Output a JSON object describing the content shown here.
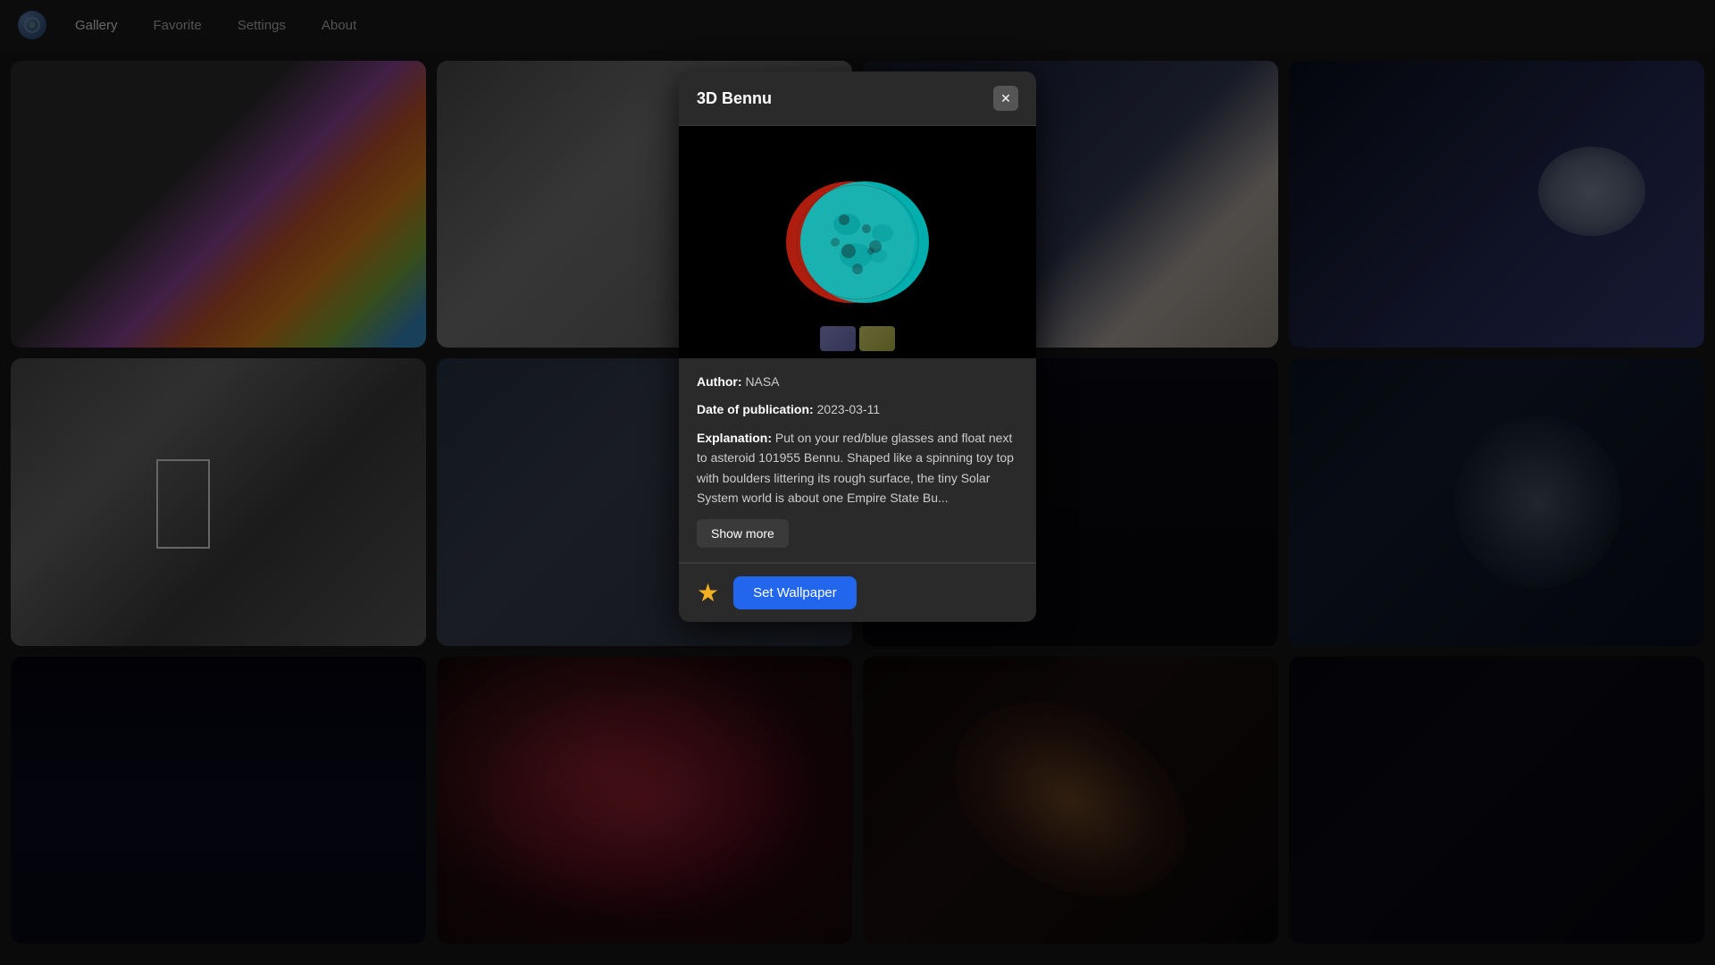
{
  "app": {
    "logo_alt": "Space Wallpaper App"
  },
  "navbar": {
    "items": [
      {
        "id": "gallery",
        "label": "Gallery",
        "active": true
      },
      {
        "id": "favorite",
        "label": "Favorite",
        "active": false
      },
      {
        "id": "settings",
        "label": "Settings",
        "active": false
      },
      {
        "id": "about",
        "label": "About",
        "active": false
      }
    ]
  },
  "modal": {
    "title": "3D Bennu",
    "close_label": "✕",
    "author_label": "Author:",
    "author_value": "NASA",
    "date_label": "Date of publication:",
    "date_value": "2023-03-11",
    "explanation_label": "Explanation:",
    "explanation_text": "Put on your red/blue glasses and float next to asteroid 101955 Bennu. Shaped like a spinning toy top with boulders littering its rough surface, the tiny Solar System world is about one Empire State Bu...",
    "show_more_label": "Show more",
    "set_wallpaper_label": "Set Wallpaper",
    "favorite_star": "★"
  },
  "gallery": {
    "items": [
      {
        "id": "rainbow",
        "class": "gi-rainbow"
      },
      {
        "id": "asteroid1",
        "class": "gi-asteroid1"
      },
      {
        "id": "nebula1",
        "class": "gi-nebula1"
      },
      {
        "id": "stars1",
        "class": "gi-stars1"
      },
      {
        "id": "rocks",
        "class": "gi-rocks"
      },
      {
        "id": "asteroid2",
        "class": "gi-asteroid2"
      },
      {
        "id": "dark1",
        "class": "gi-dark1"
      },
      {
        "id": "stars2",
        "class": "gi-stars2"
      },
      {
        "id": "dark2",
        "class": "gi-dark2"
      },
      {
        "id": "purple-nebula",
        "class": "gi-purple-nebula"
      },
      {
        "id": "galaxy",
        "class": "gi-galaxy"
      },
      {
        "id": "stars3",
        "class": "gi-stars3"
      },
      {
        "id": "fire",
        "class": "gi-fire"
      },
      {
        "id": "moon",
        "class": "gi-moon"
      },
      {
        "id": "crater",
        "class": "gi-crater"
      },
      {
        "id": "galaxy2",
        "class": "gi-galaxy2"
      }
    ]
  }
}
